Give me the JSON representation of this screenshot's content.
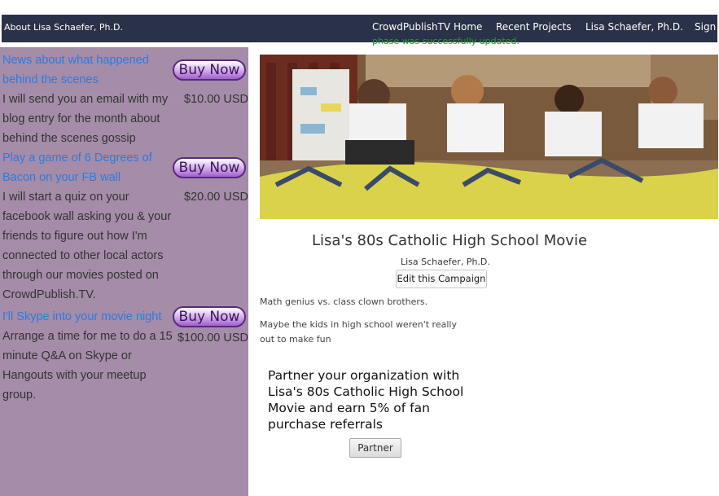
{
  "nav": {
    "brand": "About Lisa Schaefer, Ph.D.",
    "links": [
      "CrowdPublishTV Home",
      "Recent Projects",
      "Lisa Schaefer, Ph.D.",
      "Sign"
    ]
  },
  "flash_message": "phase was successfully updated.",
  "rewards": [
    {
      "title": "News about what happened behind the scenes",
      "description": "I will send you an email with my blog entry for the month about behind the scenes gossip",
      "price": "$10.00 USD",
      "button": "Buy Now"
    },
    {
      "title": "Play a game of 6 Degrees of Bacon on your FB wall",
      "description": "I will start a quiz on your facebook wall asking you & your friends to figure out how I'm connected to other local actors through our movies posted on CrowdPublish.TV.",
      "price": "$20.00 USD",
      "button": "Buy Now"
    },
    {
      "title": "I'll Skype into your movie night",
      "description": "Arrange a time for me to do a 15 minute Q&A on Skype or Hangouts with your meetup group.",
      "price": "$100.00 USD",
      "button": "Buy Now"
    }
  ],
  "campaign": {
    "title": "Lisa's 80s Catholic High School Movie",
    "author": "Lisa Schaefer, Ph.D.",
    "edit_button": "Edit this Campaign",
    "tagline": "Math genius vs. class clown brothers.",
    "description": "Maybe the kids in high school weren't really out to make fun"
  },
  "partner": {
    "text": "Partner your organization with Lisa's 80s Catholic High School Movie and earn 5% of fan purchase referrals",
    "button": "Partner"
  },
  "colors": {
    "navbar": "#2a3249",
    "sidebar": "#a58ca9",
    "link": "#2c7be0",
    "flash": "#22a02a"
  }
}
